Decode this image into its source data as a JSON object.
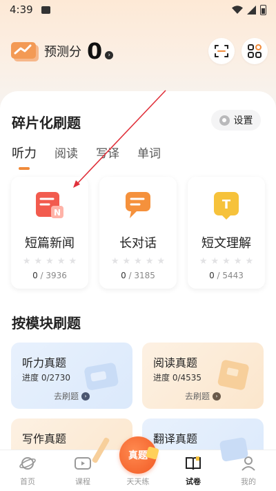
{
  "status": {
    "time": "4:39"
  },
  "header": {
    "score_label": "预测分",
    "score_value": "0"
  },
  "practice": {
    "title": "碎片化刷题",
    "settings_label": "设置",
    "tabs": [
      {
        "label": "听力",
        "active": true
      },
      {
        "label": "阅读",
        "active": false
      },
      {
        "label": "写译",
        "active": false
      },
      {
        "label": "单词",
        "active": false
      }
    ],
    "categories": [
      {
        "name": "短篇新闻",
        "done": "0",
        "total": "/ 3936",
        "stars": 0,
        "icon": "news-icon",
        "color": "#f25b4e"
      },
      {
        "name": "长对话",
        "done": "0",
        "total": "/ 3185",
        "stars": 0,
        "icon": "chat-icon",
        "color": "#f5913c"
      },
      {
        "name": "短文理解",
        "done": "0",
        "total": "/ 5443",
        "stars": 0,
        "icon": "text-icon",
        "color": "#f6c23b"
      }
    ]
  },
  "modules": {
    "title": "按模块刷题",
    "go_label": "去刷题",
    "items": [
      {
        "name": "听力真题",
        "progress": "进度 0/2730",
        "theme": "blue"
      },
      {
        "name": "阅读真题",
        "progress": "进度 0/4535",
        "theme": "orange"
      },
      {
        "name": "写作真题",
        "progress": "",
        "theme": "orange"
      },
      {
        "name": "翻译真题",
        "progress": "",
        "theme": "blue"
      }
    ]
  },
  "nav": {
    "items": [
      {
        "label": "首页",
        "icon": "planet-icon"
      },
      {
        "label": "课程",
        "icon": "video-icon"
      },
      {
        "label": "天天练",
        "icon": "daily-badge",
        "badge_text": "真题"
      },
      {
        "label": "试卷",
        "icon": "book-icon",
        "active": true
      },
      {
        "label": "我的",
        "icon": "user-icon"
      }
    ]
  },
  "colors": {
    "accent": "#f08a3a",
    "brand_red": "#f15a24"
  }
}
